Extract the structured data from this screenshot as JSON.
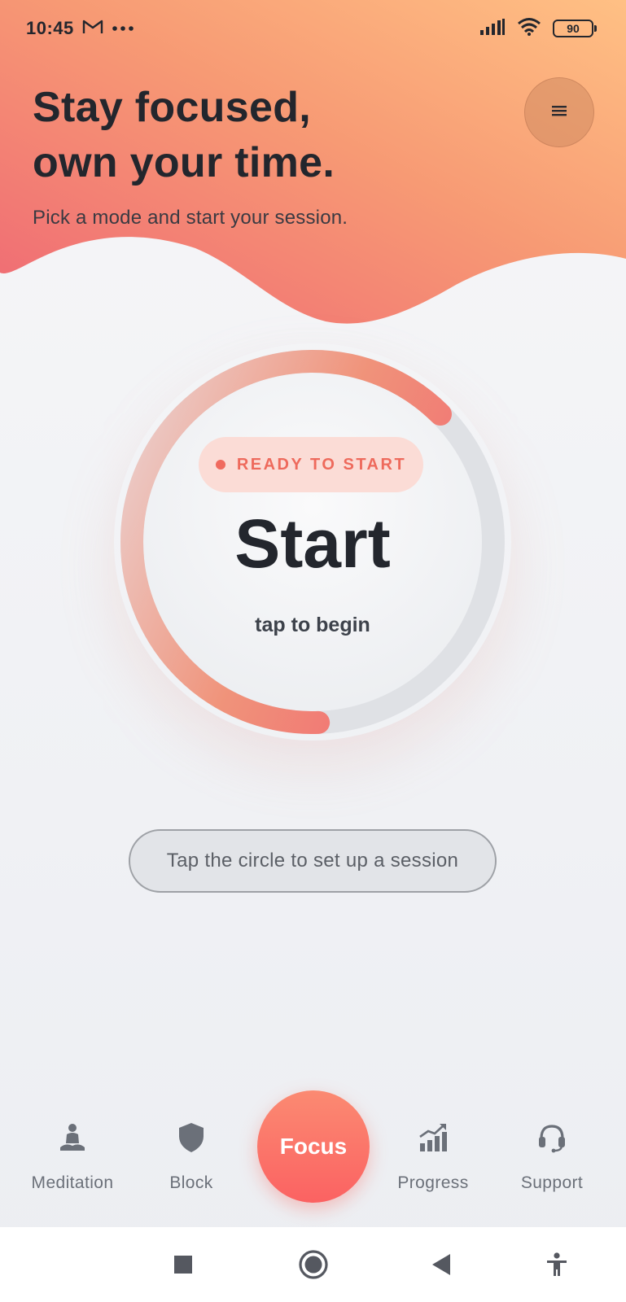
{
  "status_bar": {
    "time": "10:45",
    "battery": "90",
    "icons": [
      "gmail-icon",
      "more-dots-icon",
      "signal-icon",
      "wifi-icon",
      "battery-icon"
    ]
  },
  "header": {
    "title_line1": "Stay focused,",
    "title_line2": "own your time.",
    "subtitle": "Pick a mode and start your session.",
    "menu_icon": "menu-icon"
  },
  "timer": {
    "status_badge": "READY TO START",
    "main_label": "Start",
    "sub_label": "tap to begin",
    "progress_fraction": 0.63
  },
  "hint": "Tap the circle to set up a session",
  "bottom_nav": {
    "items": [
      {
        "label": "Meditation",
        "icon": "meditation-icon"
      },
      {
        "label": "Block",
        "icon": "shield-icon"
      },
      {
        "label": "Focus",
        "icon": ""
      },
      {
        "label": "Progress",
        "icon": "bar-chart-icon"
      },
      {
        "label": "Support",
        "icon": "headset-icon"
      }
    ]
  },
  "system_nav": [
    "recents-icon",
    "home-icon",
    "back-icon",
    "accessibility-icon"
  ],
  "colors": {
    "accent": "#fb6a62",
    "gradient_start": "#ef6b74",
    "gradient_end": "#fdbf80",
    "text_dark": "#23262d"
  }
}
